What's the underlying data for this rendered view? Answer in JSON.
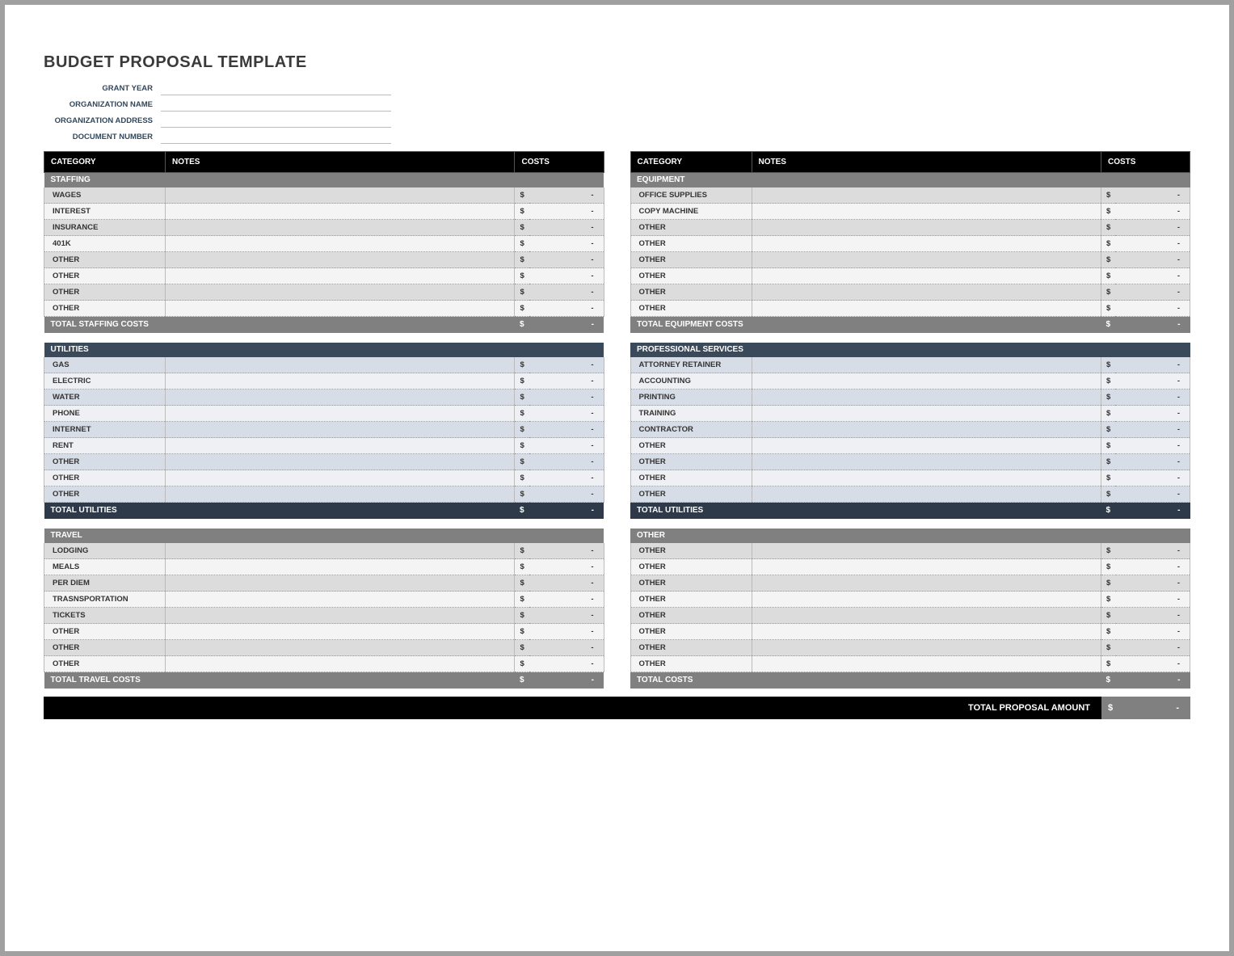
{
  "title": "BUDGET PROPOSAL TEMPLATE",
  "info_labels": {
    "grant_year": "GRANT YEAR",
    "org_name": "ORGANIZATION NAME",
    "org_address": "ORGANIZATION ADDRESS",
    "doc_number": "DOCUMENT NUMBER"
  },
  "info_values": {
    "grant_year": "",
    "org_name": "",
    "org_address": "",
    "doc_number": ""
  },
  "headers": {
    "category": "CATEGORY",
    "notes": "NOTES",
    "costs": "COSTS"
  },
  "currency": "$",
  "dash": "-",
  "sections": {
    "staffing": {
      "title": "STAFFING",
      "total_label": "TOTAL STAFFING COSTS",
      "items": [
        "WAGES",
        "INTEREST",
        "INSURANCE",
        "401K",
        "OTHER",
        "OTHER",
        "OTHER",
        "OTHER"
      ]
    },
    "utilities": {
      "title": "UTILITIES",
      "total_label": "TOTAL UTILITIES",
      "items": [
        "GAS",
        "ELECTRIC",
        "WATER",
        "PHONE",
        "INTERNET",
        "RENT",
        "OTHER",
        "OTHER",
        "OTHER"
      ]
    },
    "travel": {
      "title": "TRAVEL",
      "total_label": "TOTAL TRAVEL COSTS",
      "items": [
        "LODGING",
        "MEALS",
        "PER DIEM",
        "TRASNSPORTATION",
        "TICKETS",
        "OTHER",
        "OTHER",
        "OTHER"
      ]
    },
    "equipment": {
      "title": "EQUIPMENT",
      "total_label": "TOTAL EQUIPMENT COSTS",
      "items": [
        "OFFICE SUPPLIES",
        "COPY MACHINE",
        "OTHER",
        "OTHER",
        "OTHER",
        "OTHER",
        "OTHER",
        "OTHER"
      ]
    },
    "professional": {
      "title": "PROFESSIONAL SERVICES",
      "total_label": "TOTAL UTILITIES",
      "items": [
        "ATTORNEY RETAINER",
        "ACCOUNTING",
        "PRINTING",
        "TRAINING",
        "CONTRACTOR",
        "OTHER",
        "OTHER",
        "OTHER",
        "OTHER"
      ]
    },
    "other": {
      "title": "OTHER",
      "total_label": "TOTAL COSTS",
      "items": [
        "OTHER",
        "OTHER",
        "OTHER",
        "OTHER",
        "OTHER",
        "OTHER",
        "OTHER",
        "OTHER"
      ]
    }
  },
  "grand_total_label": "TOTAL PROPOSAL AMOUNT"
}
